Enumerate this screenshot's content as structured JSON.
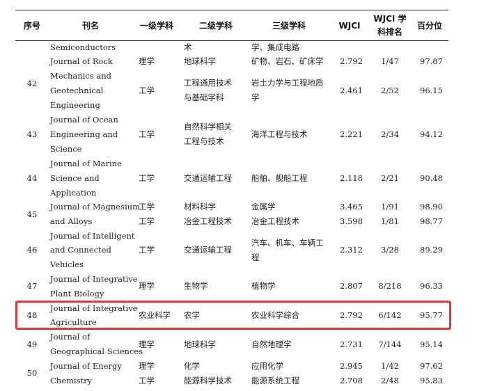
{
  "headers": {
    "seq": "序号",
    "journal": "刊名",
    "level1": "一级学科",
    "level2": "二级学科",
    "level3": "三级学科",
    "wjci": "WJCI",
    "rank_line1": "WJCI 学",
    "rank_line2": "科排名",
    "percentile": "百分位"
  },
  "rows": [
    {
      "no": "",
      "journal": [
        "Semiconductors"
      ],
      "lines": [
        {
          "l1": "",
          "l2": "术",
          "l3": "学、集成电路",
          "wjci": "",
          "rank": "",
          "pct": ""
        }
      ]
    },
    {
      "no": "42",
      "journal": [
        "Journal of Rock",
        "Mechanics and",
        "Geotechnical",
        "Engineering"
      ],
      "lines": [
        {
          "l1": "理学",
          "l2": "地球科学",
          "l3": "矿物、岩石、矿床学",
          "wjci": "2.792",
          "rank": "1/47",
          "pct": "97.87"
        },
        {
          "l1": "工学",
          "l2a": "工程通用技术",
          "l2b": "与基础学科",
          "l3a": "岩土力学与工程地质",
          "l3b": "学",
          "wjci": "2.461",
          "rank": "2/52",
          "pct": "96.15"
        }
      ]
    },
    {
      "no": "43",
      "journal": [
        "Journal of Ocean",
        "Engineering and",
        "Science"
      ],
      "lines": [
        {
          "l1": "工学",
          "l2a": "自然科学相关",
          "l2b": "工程与技术",
          "l3": "海洋工程与技术",
          "wjci": "2.221",
          "rank": "2/34",
          "pct": "94.12"
        }
      ]
    },
    {
      "no": "44",
      "journal": [
        "Journal of Marine",
        "Science and",
        "Application"
      ],
      "lines": [
        {
          "l1": "工学",
          "l2": "交通运输工程",
          "l3": "船舶、舰船工程",
          "wjci": "2.118",
          "rank": "2/21",
          "pct": "90.48"
        }
      ]
    },
    {
      "no": "45",
      "journal": [
        "Journal of Magnesium",
        "and Alloys"
      ],
      "lines": [
        {
          "l1": "工学",
          "l2": "材料科学",
          "l3": "金属学",
          "wjci": "3.465",
          "rank": "1/91",
          "pct": "98.90"
        },
        {
          "l1": "工学",
          "l2": "冶金工程技术",
          "l3": "冶金工程技术",
          "wjci": "3.598",
          "rank": "1/81",
          "pct": "98.77"
        }
      ]
    },
    {
      "no": "46",
      "journal": [
        "Journal of Intelligent",
        "and Connected",
        "Vehicles"
      ],
      "lines": [
        {
          "l1": "工学",
          "l2": "交通运输工程",
          "l3a": "汽车、机车、车辆工",
          "l3b": "程",
          "wjci": "2.312",
          "rank": "3/28",
          "pct": "89.29"
        }
      ]
    },
    {
      "no": "47",
      "journal": [
        "Journal of Integrative",
        "Plant Biology"
      ],
      "lines": [
        {
          "l1": "理学",
          "l2": "生物学",
          "l3": "植物学",
          "wjci": "2.807",
          "rank": "8/218",
          "pct": "96.33"
        }
      ]
    },
    {
      "no": "48",
      "journal": [
        "Journal of Integrative",
        "Agriculture"
      ],
      "lines": [
        {
          "l1": "农业科学",
          "l2": "农学",
          "l3": "农业科学综合",
          "wjci": "2.792",
          "rank": "6/142",
          "pct": "95.77"
        }
      ]
    },
    {
      "no": "49",
      "journal": [
        "Journal of",
        "Geographical Sciences"
      ],
      "lines": [
        {
          "l1": "理学",
          "l2": "地球科学",
          "l3": "自然地理学",
          "wjci": "2.731",
          "rank": "7/144",
          "pct": "95.14"
        }
      ]
    },
    {
      "no": "50",
      "journal": [
        "Journal of Energy",
        "Chemistry"
      ],
      "lines": [
        {
          "l1": "理学",
          "l2": "化学",
          "l3": "应用化学",
          "wjci": "2.945",
          "rank": "1/42",
          "pct": "97.62"
        },
        {
          "l1": "工学",
          "l2": "能源科学技术",
          "l3": "能源系统工程",
          "wjci": "2.708",
          "rank": "2/48",
          "pct": "95.83"
        }
      ]
    }
  ],
  "colors": {
    "highlight_border": "#e0393a",
    "rule": "#222222"
  }
}
